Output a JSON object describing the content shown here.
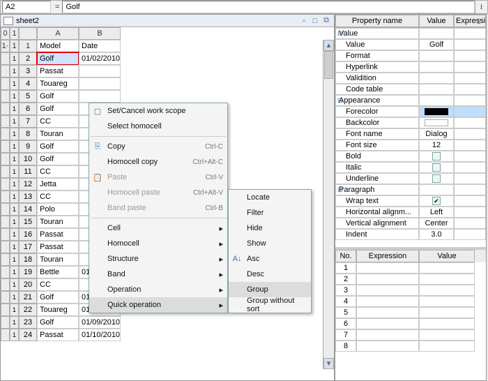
{
  "formula_bar": {
    "cell_ref": "A2",
    "value": "Golf"
  },
  "sheet": {
    "title": "sheet2"
  },
  "levels_top": [
    "0",
    "1"
  ],
  "levels_side": [
    "1·",
    "1"
  ],
  "columns": [
    "A",
    "B"
  ],
  "header_row": {
    "a": "Model",
    "b": "Date"
  },
  "rows": [
    {
      "n": "2",
      "a": "Golf",
      "b": "01/02/2010",
      "sel": true
    },
    {
      "n": "3",
      "a": "Passat",
      "b": ""
    },
    {
      "n": "4",
      "a": "Touareg",
      "b": ""
    },
    {
      "n": "5",
      "a": "Golf",
      "b": ""
    },
    {
      "n": "6",
      "a": "Golf",
      "b": ""
    },
    {
      "n": "7",
      "a": "CC",
      "b": ""
    },
    {
      "n": "8",
      "a": "Touran",
      "b": ""
    },
    {
      "n": "9",
      "a": "Golf",
      "b": ""
    },
    {
      "n": "10",
      "a": "Golf",
      "b": ""
    },
    {
      "n": "11",
      "a": "CC",
      "b": ""
    },
    {
      "n": "12",
      "a": "Jetta",
      "b": ""
    },
    {
      "n": "13",
      "a": "CC",
      "b": ""
    },
    {
      "n": "14",
      "a": "Polo",
      "b": ""
    },
    {
      "n": "15",
      "a": "Touran",
      "b": ""
    },
    {
      "n": "16",
      "a": "Passat",
      "b": ""
    },
    {
      "n": "17",
      "a": "Passat",
      "b": ""
    },
    {
      "n": "18",
      "a": "Touran",
      "b": ""
    },
    {
      "n": "19",
      "a": "Bettle",
      "b": "01/07/2010"
    },
    {
      "n": "20",
      "a": "CC",
      "b": ""
    },
    {
      "n": "21",
      "a": "Golf",
      "b": "01/08/2010"
    },
    {
      "n": "22",
      "a": "Touareg",
      "b": "01/08/2010"
    },
    {
      "n": "23",
      "a": "Golf",
      "b": "01/09/2010"
    },
    {
      "n": "24",
      "a": "Passat",
      "b": "01/10/2010"
    }
  ],
  "context_menu": {
    "items": [
      {
        "label": "Set/Cancel work scope",
        "icon": "▢"
      },
      {
        "label": "Select homocell"
      },
      {
        "sep": true
      },
      {
        "label": "Copy",
        "shortcut": "Ctrl-C",
        "icon": "⎘"
      },
      {
        "label": "Homocell copy",
        "shortcut": "Ctrl+Alt-C"
      },
      {
        "label": "Paste",
        "shortcut": "Ctrl-V",
        "disabled": true,
        "icon": "📋"
      },
      {
        "label": "Homocell paste",
        "shortcut": "Ctrl+Alt-V",
        "disabled": true
      },
      {
        "label": "Band paste",
        "shortcut": "Ctrl-B",
        "disabled": true
      },
      {
        "sep": true
      },
      {
        "label": "Cell",
        "submenu": true
      },
      {
        "label": "Homocell",
        "submenu": true
      },
      {
        "label": "Structure",
        "submenu": true
      },
      {
        "label": "Band",
        "submenu": true
      },
      {
        "label": "Operation",
        "submenu": true
      },
      {
        "label": "Quick operation",
        "submenu": true,
        "hl": true
      }
    ],
    "submenu": [
      {
        "label": "Locate"
      },
      {
        "label": "Filter"
      },
      {
        "label": "Hide"
      },
      {
        "label": "Show"
      },
      {
        "label": "Asc",
        "icon": "A↓"
      },
      {
        "label": "Desc"
      },
      {
        "label": "Group",
        "hl": true
      },
      {
        "label": "Group without sort"
      }
    ]
  },
  "properties": {
    "headers": {
      "c1": "Property name",
      "c2": "Value",
      "c3": "Expressi..."
    },
    "rows": [
      {
        "group": true,
        "name": "Value",
        "tw": "⊟"
      },
      {
        "name": "Value",
        "value": "Golf"
      },
      {
        "name": "Format"
      },
      {
        "name": "Hyperlink"
      },
      {
        "name": "Validition"
      },
      {
        "name": "Code table"
      },
      {
        "group": true,
        "name": "Appearance",
        "tw": "⊟"
      },
      {
        "name": "Forecolor",
        "swatch": "black",
        "sel": true
      },
      {
        "name": "Backcolor",
        "swatch": "white"
      },
      {
        "name": "Font name",
        "value": "Dialog"
      },
      {
        "name": "Font size",
        "value": "12"
      },
      {
        "name": "Bold",
        "check": ""
      },
      {
        "name": "Italic",
        "check": ""
      },
      {
        "name": "Underline",
        "check": ""
      },
      {
        "group": true,
        "name": "Paragraph",
        "tw": "⊟"
      },
      {
        "name": "Wrap text",
        "check": "on"
      },
      {
        "name": "Horizontal alignm...",
        "value": "Left"
      },
      {
        "name": "Vertical alignment",
        "value": "Center"
      },
      {
        "name": "Indent",
        "value": "3.0"
      }
    ]
  },
  "expression_table": {
    "headers": {
      "n": "No.",
      "e": "Expression",
      "v": "Value"
    },
    "rows": [
      "1",
      "2",
      "3",
      "4",
      "5",
      "6",
      "7",
      "8"
    ]
  }
}
